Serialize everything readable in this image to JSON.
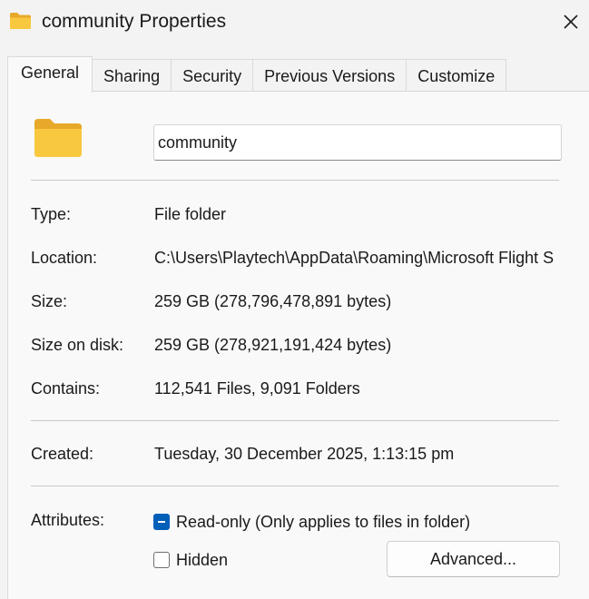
{
  "window": {
    "title": "community Properties",
    "icon": "folder-icon",
    "close_icon": "close-icon"
  },
  "tabs": [
    {
      "label": "General",
      "active": true
    },
    {
      "label": "Sharing",
      "active": false
    },
    {
      "label": "Security",
      "active": false
    },
    {
      "label": "Previous Versions",
      "active": false
    },
    {
      "label": "Customize",
      "active": false
    }
  ],
  "general": {
    "folder_name": "community",
    "properties": {
      "type": {
        "label": "Type:",
        "value": "File folder"
      },
      "location": {
        "label": "Location:",
        "value": "C:\\Users\\Playtech\\AppData\\Roaming\\Microsoft Flight S"
      },
      "size": {
        "label": "Size:",
        "value": "259 GB (278,796,478,891 bytes)"
      },
      "size_on_disk": {
        "label": "Size on disk:",
        "value": "259 GB (278,921,191,424 bytes)"
      },
      "contains": {
        "label": "Contains:",
        "value": "112,541 Files, 9,091 Folders"
      },
      "created": {
        "label": "Created:",
        "value": "Tuesday, 30 December 2025, 1:13:15 pm"
      }
    },
    "attributes": {
      "label": "Attributes:",
      "read_only": {
        "label": "Read-only (Only applies to files in folder)",
        "state": "indeterminate"
      },
      "hidden": {
        "label": "Hidden",
        "state": "unchecked"
      },
      "advanced_button": "Advanced..."
    }
  },
  "colors": {
    "accent": "#005fb8",
    "folder_yellow": "#f8c83f",
    "folder_tab": "#e8a92a",
    "window_bg": "#f3f3f3",
    "panel_bg": "#f9f9f9"
  }
}
